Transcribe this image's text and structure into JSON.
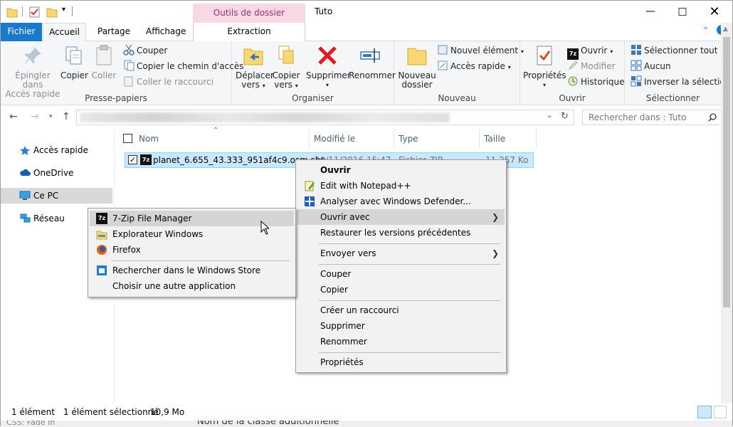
{
  "window": {
    "title": "Tuto",
    "contextual_tab_title": "Outils de dossier compressé"
  },
  "tabs": {
    "file": "Fichier",
    "home": "Accueil",
    "share": "Partage",
    "view": "Affichage",
    "extract": "Extraction"
  },
  "ribbon": {
    "clipboard": {
      "label": "Presse-papiers",
      "pin_line1": "Épingler dans",
      "pin_line2": "Accès rapide",
      "copy": "Copier",
      "paste": "Coller",
      "cut": "Couper",
      "copy_path": "Copier le chemin d'accès",
      "paste_shortcut": "Coller le raccourci"
    },
    "organize": {
      "label": "Organiser",
      "move_line1": "Déplacer",
      "move_line2": "vers",
      "copyto_line1": "Copier",
      "copyto_line2": "vers",
      "delete": "Supprimer",
      "rename": "Renommer"
    },
    "new": {
      "label": "Nouveau",
      "folder_line1": "Nouveau",
      "folder_line2": "dossier",
      "new_item": "Nouvel élément",
      "quick_access": "Accès rapide"
    },
    "open": {
      "label": "Ouvrir",
      "properties": "Propriétés",
      "open": "Ouvrir",
      "edit": "Modifier",
      "history": "Historique"
    },
    "select": {
      "label": "Sélectionner",
      "select_all": "Sélectionner tout",
      "none": "Aucun",
      "invert": "Inverser la sélection"
    }
  },
  "search": {
    "placeholder": "Rechercher dans : Tuto"
  },
  "nav": {
    "items": [
      {
        "label": "Accès rapide"
      },
      {
        "label": "OneDrive"
      },
      {
        "label": "Ce PC"
      },
      {
        "label": "Réseau"
      }
    ]
  },
  "columns": {
    "name": "Nom",
    "modified": "Modifié le",
    "type": "Type",
    "size": "Taille"
  },
  "file": {
    "name": "planet_6.655_43.333_951af4c9.osm.shp",
    "date": "10/11/2016 15:47",
    "type": "Fichier ZIP",
    "size": "11 257 Ko"
  },
  "status": {
    "count": "1 élément",
    "selected": "1 élément sélectionné",
    "size": "10,9 Mo"
  },
  "context_menu": {
    "open": "Ouvrir",
    "notepad": "Edit with Notepad++",
    "defender": "Analyser avec Windows Defender...",
    "open_with": "Ouvrir avec",
    "restore": "Restaurer les versions précédentes",
    "send_to": "Envoyer vers",
    "cut": "Couper",
    "copy": "Copier",
    "shortcut": "Créer un raccourci",
    "delete": "Supprimer",
    "rename": "Renommer",
    "properties": "Propriétés"
  },
  "submenu": {
    "zip": "7-Zip File Manager",
    "explorer": "Explorateur Windows",
    "firefox": "Firefox",
    "store": "Rechercher dans le Windows Store",
    "choose": "Choisir une autre application"
  },
  "background": {
    "ghost_left": "CSS: Fade In",
    "ghost_mid": "Nom de la classe additionnelle"
  },
  "colors": {
    "file_tab": "#1979ca",
    "selection": "#cce8ff",
    "context_tab": "#f7d9e6"
  }
}
